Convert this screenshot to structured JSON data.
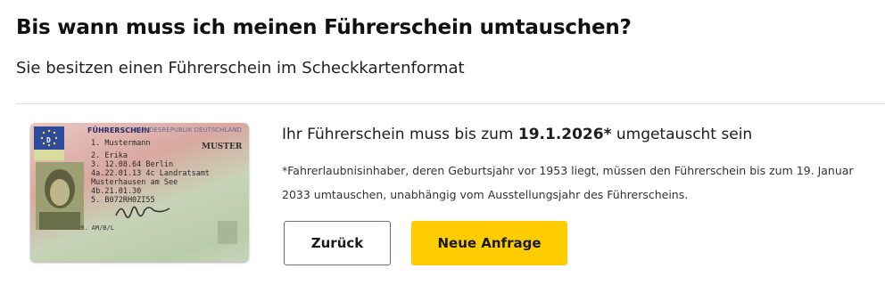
{
  "page": {
    "title": "Bis wann muss ich meinen Führerschein umtauschen?",
    "subtitle": "Sie besitzen einen Führerschein im Scheckkartenformat"
  },
  "card": {
    "header": "FÜHRERSCHEIN",
    "header_country": "BUNDESREPUBLIK DEUTSCHLAND",
    "country_code": "D",
    "muster": "MUSTER",
    "lines": [
      "1. Mustermann",
      "2. Erika",
      "3. 12.08.64  Berlin",
      "4a.22.01.13  4c Landratsamt",
      "   Musterhausen am See",
      "4b.21.01.30",
      "5. B072RH0ZI55"
    ],
    "categories": "9. AM/B/L"
  },
  "result": {
    "deadline_prefix": "Ihr Führerschein muss bis zum",
    "deadline_date": "19.1.2026*",
    "deadline_suffix": "umgetauscht sein",
    "footnote": "*Fahrerlaubnisinhaber, deren Geburtsjahr vor 1953 liegt, müssen den Führerschein bis zum 19. Januar 2033 umtauschen, unabhängig vom Ausstellungsjahr des Führerscheins."
  },
  "buttons": {
    "back_label": "Zurück",
    "new_request_label": "Neue Anfrage"
  },
  "colors": {
    "primary_button": "#ffcc00",
    "secondary_button_border": "#7a6e64"
  }
}
